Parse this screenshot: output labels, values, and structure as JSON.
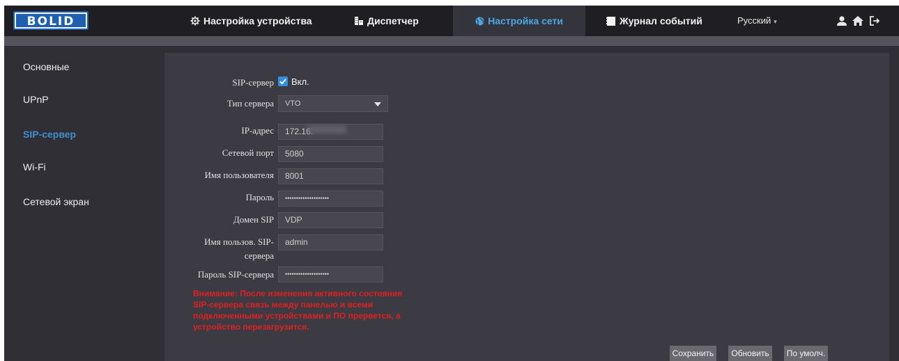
{
  "brand": {
    "logo_text": "BOLID"
  },
  "nav": {
    "device_settings": "Настройка устройства",
    "dispatcher": "Диспетчер",
    "network_settings": "Настройка сети",
    "event_log": "Журнал событий",
    "language": "Русский"
  },
  "sidebar": {
    "items": [
      {
        "label": "Основные"
      },
      {
        "label": "UPnP"
      },
      {
        "label": "SIP-сервер"
      },
      {
        "label": "Wi-Fi"
      },
      {
        "label": "Сетевой экран"
      }
    ],
    "active_index": 2
  },
  "form": {
    "sip_server_label": "SIP-сервер",
    "sip_enabled": true,
    "sip_enabled_label": "Вкл.",
    "server_type_label": "Тип сервера",
    "server_type_value": "VTO",
    "ip_label": "IP-адрес",
    "ip_value": "172.16.",
    "port_label": "Сетевой порт",
    "port_value": "5080",
    "username_label": "Имя пользователя",
    "username_value": "8001",
    "password_label": "Пароль",
    "password_value": "••••••••••••••••••••",
    "domain_label": "Домен SIP",
    "domain_value": "VDP",
    "sip_user_label_line1": "Имя пользов. SIP-",
    "sip_user_label_line2": "сервера",
    "sip_user_value": "admin",
    "sip_password_label": "Пароль SIP-сервера",
    "sip_password_value": "••••••••••••••••••••"
  },
  "warning": {
    "line1": "Внимание: После изменения активного состояния",
    "line2": "SIP-сервера связь между панелью и всеми",
    "line3": "подключенными устройствами и ПО прервется, а",
    "line4": "устройство перезагрузится."
  },
  "buttons": {
    "save": "Сохранить",
    "refresh": "Обновить",
    "default": "По умолч."
  },
  "colors": {
    "accent": "#3d8fd0",
    "warning": "#e02020",
    "checkbox": "#2f8fe3"
  }
}
